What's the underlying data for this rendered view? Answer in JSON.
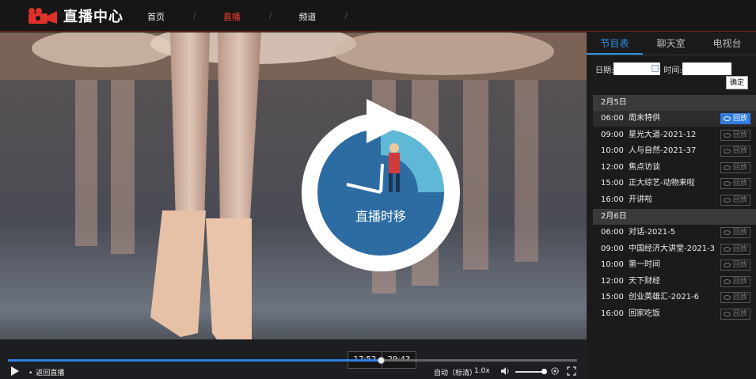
{
  "brand": {
    "name": "直播中心",
    "logo_icon": "camera-icon",
    "accent": "#e0302a"
  },
  "nav": [
    {
      "label": "首页",
      "active": false
    },
    {
      "label": "直播",
      "active": true
    },
    {
      "label": "频道",
      "active": false
    }
  ],
  "nav_separator": "/",
  "player": {
    "overlay_text": "直播时移",
    "time_current": "17:52",
    "time_end": "29:43",
    "progress": 0.655,
    "return_live": "返回直播",
    "quality": "自动（标清）",
    "speed": "1.0x",
    "volume": 1.0
  },
  "sidebar": {
    "tabs": [
      {
        "label": "节目表",
        "active": true
      },
      {
        "label": "聊天室",
        "active": false
      },
      {
        "label": "电视台",
        "active": false
      }
    ],
    "date_label": "日期:",
    "time_label": "时间:",
    "confirm_label": "确定",
    "replay_label": "回放",
    "days": [
      {
        "date": "2月5日",
        "programs": [
          {
            "time": "06:00",
            "title": "周末特供",
            "active": true
          },
          {
            "time": "09:00",
            "title": "星光大道-2021-12",
            "active": false
          },
          {
            "time": "10:00",
            "title": "人与自然-2021-37",
            "active": false
          },
          {
            "time": "12:00",
            "title": "焦点访谈",
            "active": false
          },
          {
            "time": "15:00",
            "title": "正大综艺-动物来啦",
            "active": false
          },
          {
            "time": "16:00",
            "title": "开讲啦",
            "active": false
          }
        ]
      },
      {
        "date": "2月6日",
        "programs": [
          {
            "time": "06:00",
            "title": "对话-2021-5",
            "active": false
          },
          {
            "time": "09:00",
            "title": "中国经济大讲堂-2021-3",
            "active": false
          },
          {
            "time": "10:00",
            "title": "第一时间",
            "active": false
          },
          {
            "time": "12:00",
            "title": "天下财经",
            "active": false
          },
          {
            "time": "15:00",
            "title": "创业英雄汇-2021-6",
            "active": false
          },
          {
            "time": "16:00",
            "title": "回家吃饭",
            "active": false
          }
        ]
      }
    ]
  }
}
